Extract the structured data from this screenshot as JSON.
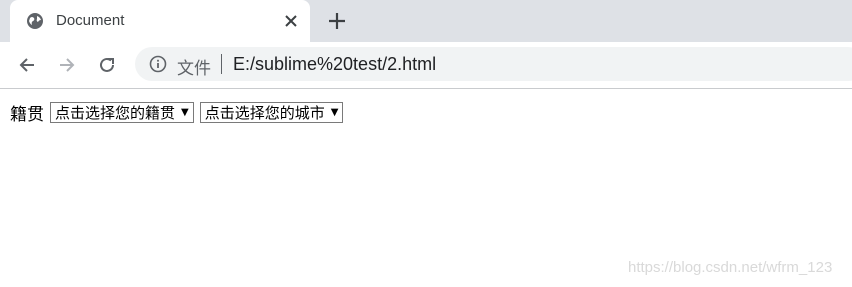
{
  "tab": {
    "title": "Document",
    "favicon": "globe-icon"
  },
  "toolbar": {
    "back_icon": "arrow-left-icon",
    "forward_icon": "arrow-right-icon",
    "reload_icon": "reload-icon",
    "security_label": "文件",
    "url": "E:/sublime%20test/2.html"
  },
  "page": {
    "label": "籍贯",
    "selects": [
      {
        "value": "点击选择您的籍贯"
      },
      {
        "value": "点击选择您的城市"
      }
    ]
  },
  "watermark": "https://blog.csdn.net/wfrm_123",
  "colors": {
    "tabstrip": "#dee1e6",
    "omnibox": "#f1f3f4"
  }
}
